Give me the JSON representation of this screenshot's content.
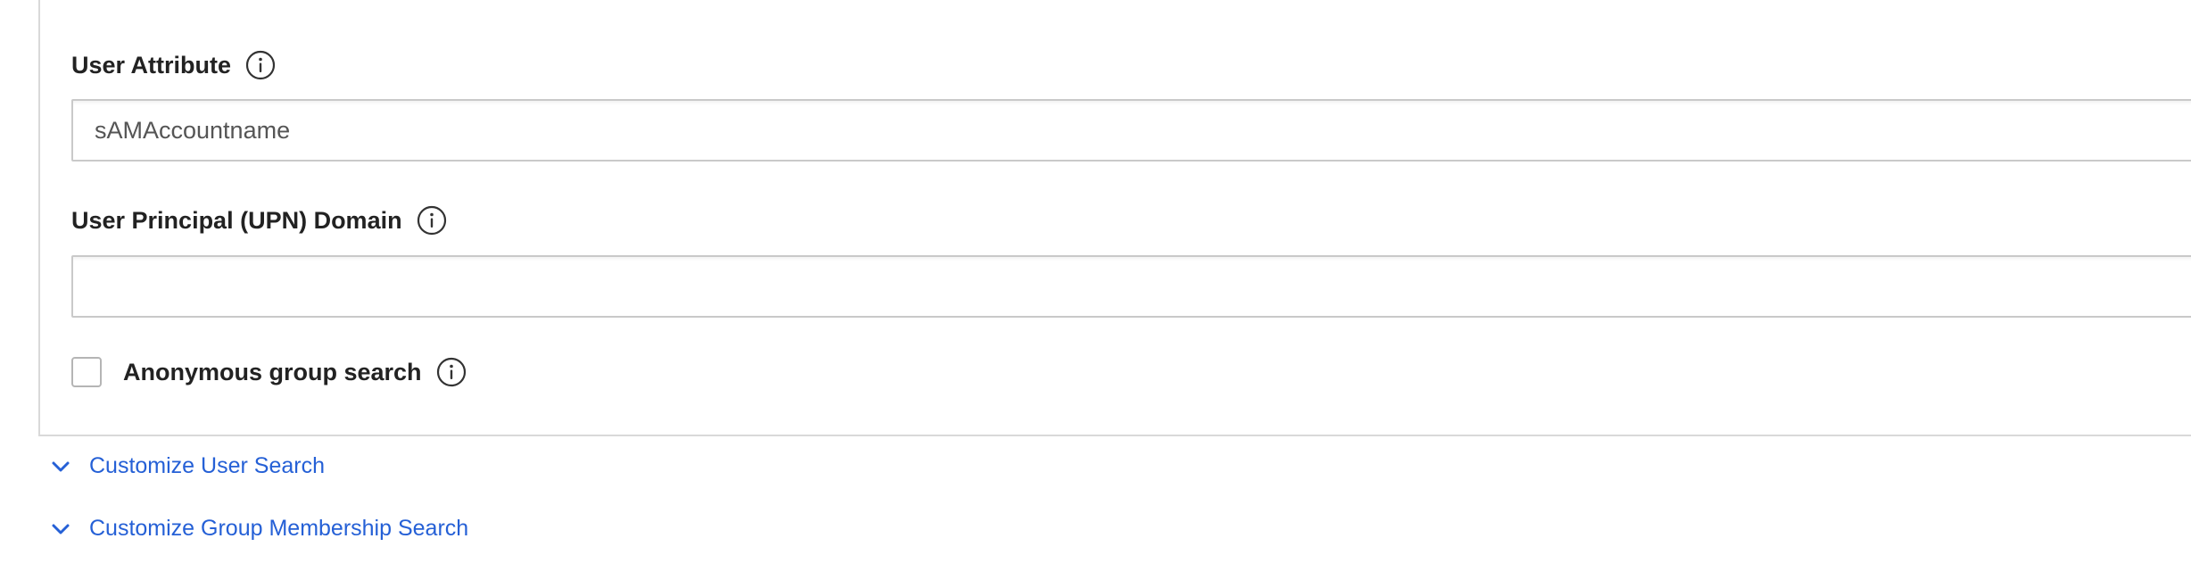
{
  "form": {
    "user_attribute": {
      "label": "User Attribute",
      "value": "sAMAccountname",
      "info_icon": "info-icon"
    },
    "upn_domain": {
      "label": "User Principal (UPN) Domain",
      "value": "",
      "info_icon": "info-icon"
    },
    "anonymous_group_search": {
      "label": "Anonymous group search",
      "checked": false,
      "info_icon": "info-icon"
    }
  },
  "expanders": {
    "customize_user_search": {
      "label": "Customize User Search",
      "icon": "chevron-down-icon"
    },
    "customize_group_membership_search": {
      "label": "Customize Group Membership Search",
      "icon": "chevron-down-icon"
    }
  },
  "colors": {
    "link": "#2560d6",
    "border": "#c9c9c9",
    "text": "#222222"
  }
}
